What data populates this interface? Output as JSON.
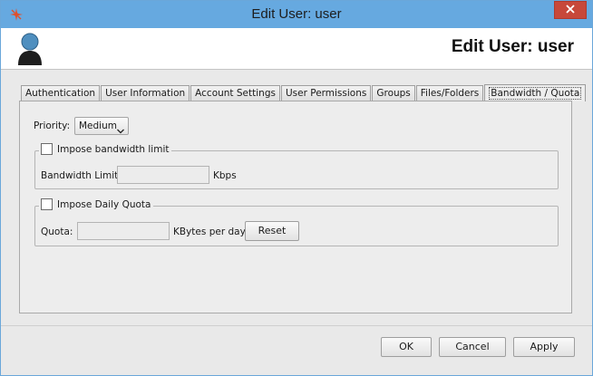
{
  "window": {
    "title": "Edit User: user",
    "app_icon": "app-logo-icon",
    "close_icon": "close-icon"
  },
  "banner": {
    "title": "Edit User: user",
    "avatar_icon": "user-avatar-icon"
  },
  "tabs": [
    {
      "label": "Authentication",
      "active": false
    },
    {
      "label": "User Information",
      "active": false
    },
    {
      "label": "Account Settings",
      "active": false
    },
    {
      "label": "User Permissions",
      "active": false
    },
    {
      "label": "Groups",
      "active": false
    },
    {
      "label": "Files/Folders",
      "active": false
    },
    {
      "label": "Bandwidth / Quota",
      "active": true
    }
  ],
  "bandwidth": {
    "priority_label": "Priority:",
    "priority_value": "Medium",
    "limit_group_label": "Impose bandwidth limit",
    "limit_checked": false,
    "limit_field_label": "Bandwidth Limit:",
    "limit_value": "",
    "limit_unit": "Kbps",
    "quota_group_label": "Impose Daily Quota",
    "quota_checked": false,
    "quota_field_label": "Quota:",
    "quota_value": "",
    "quota_unit": "KBytes per day",
    "reset_label": "Reset"
  },
  "footer": {
    "ok_label": "OK",
    "cancel_label": "Cancel",
    "apply_label": "Apply"
  },
  "colors": {
    "titlebar": "#66a9e0",
    "close_button": "#c7483a",
    "app_icon": "#e0502c"
  }
}
